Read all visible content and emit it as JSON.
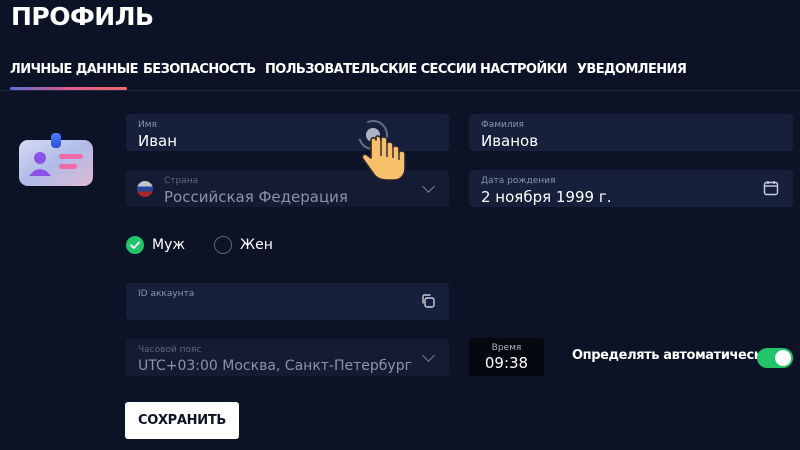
{
  "page": {
    "title": "ПРОФИЛЬ"
  },
  "tabs": [
    {
      "label": "ЛИЧНЫЕ ДАННЫЕ",
      "active": true
    },
    {
      "label": "БЕЗОПАСНОСТЬ",
      "active": false
    },
    {
      "label": "ПОЛЬЗОВАТЕЛЬСКИЕ СЕССИИ",
      "active": false
    },
    {
      "label": "НАСТРОЙКИ",
      "active": false
    },
    {
      "label": "УВЕДОМЛЕНИЯ",
      "active": false
    }
  ],
  "colors": {
    "background": "#0d1327",
    "field": "#16203a",
    "accent_green": "#22c46a",
    "tab_underline_start": "#5b6fd8",
    "tab_underline_end": "#ef6b6b"
  },
  "form": {
    "first_name": {
      "label": "Имя",
      "value": "Иван"
    },
    "last_name": {
      "label": "Фамилия",
      "value": "Иванов"
    },
    "country": {
      "label": "Страна",
      "value": "Российская Федерация",
      "icon": "russia-flag-icon"
    },
    "birth_date": {
      "label": "Дата рождения",
      "value": "2 ноября 1999 г.",
      "icon": "calendar-icon"
    },
    "gender": {
      "options": [
        {
          "label": "Муж",
          "checked": true
        },
        {
          "label": "Жен",
          "checked": false
        }
      ]
    },
    "account_id": {
      "label": "ID аккаунта",
      "value": "",
      "icon": "copy-icon"
    },
    "timezone": {
      "label": "Часовой пояс",
      "value": "UTC+03:00 Москва, Санкт-Петербург"
    },
    "time": {
      "label": "Время",
      "value": "09:38"
    },
    "auto_detect": {
      "label": "Определять автоматически",
      "enabled": true
    },
    "save_label": "СОХРАНИТЬ"
  },
  "icons": {
    "avatar": "id-badge-icon",
    "cursor": "pointing-hand-icon"
  }
}
